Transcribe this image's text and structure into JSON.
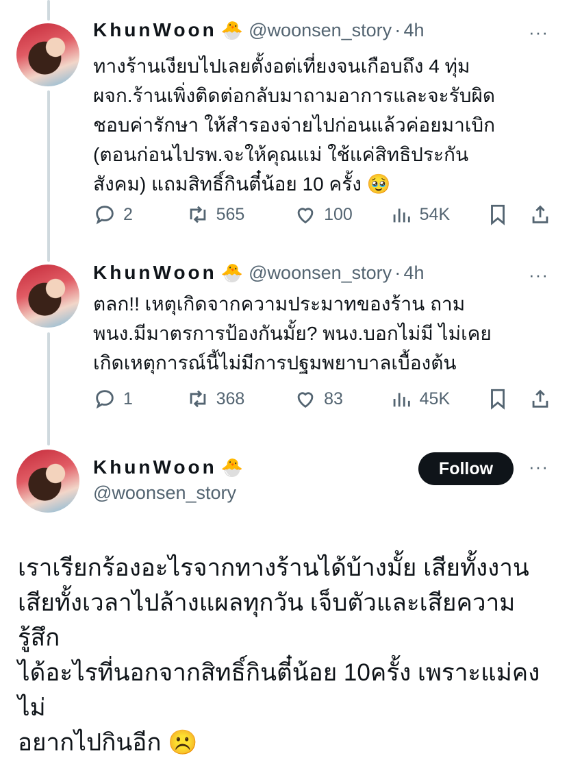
{
  "tweets": [
    {
      "name": "KhunWoon",
      "emoji": "🐣",
      "handle": "@woonsen_story",
      "time": "4h",
      "more": "···",
      "text": "ทางร้านเงียบไปเลยตั้งอต่เที่ยงจนเกือบถึง 4 ทุ่ม\nผจก.ร้านเพิ่งติดต่อกลับมาถามอาการและจะรับผิด\nชอบค่ารักษา ให้สำรองจ่ายไปก่อนแล้วค่อยมาเบิก\n(ตอนก่อนไปรพ.จะให้คุณแม่ ใช้แค่สิทธิประกัน\nสังคม) แถมสิทธิ์กินตี๋น้อย 10 ครั้ง 🥹",
      "replies": "2",
      "retweets": "565",
      "likes": "100",
      "views": "54K"
    },
    {
      "name": "KhunWoon",
      "emoji": "🐣",
      "handle": "@woonsen_story",
      "time": "4h",
      "more": "···",
      "text": "ตลก!! เหตุเกิดจากความประมาทของร้าน ถาม\nพนง.มีมาตรการป้องกันมั้ย? พนง.บอกไม่มี ไม่เคย\nเกิดเหตุการณ์นี้ไม่มีการปฐมพยาบาลเบื้องต้น",
      "replies": "1",
      "retweets": "368",
      "likes": "83",
      "views": "45K"
    }
  ],
  "main": {
    "name": "KhunWoon",
    "emoji": "🐣",
    "handle": "@woonsen_story",
    "follow_label": "Follow",
    "more": "···",
    "text": "เราเรียกร้องอะไรจากทางร้านได้บ้างมั้ย เสียทั้งงาน\nเสียทั้งเวลาไปล้างแผลทุกวัน เจ็บตัวและเสียความรู้สึก\nได้อะไรที่นอกจากสิทธิ์กินตี๋น้อย 10ครั้ง เพราะแม่คงไม่\nอยากไปกินอีก ☹️"
  },
  "colors": {
    "secondary_text": "#536471",
    "thread_line": "#cfd9de",
    "follow_bg": "#0f1419"
  }
}
